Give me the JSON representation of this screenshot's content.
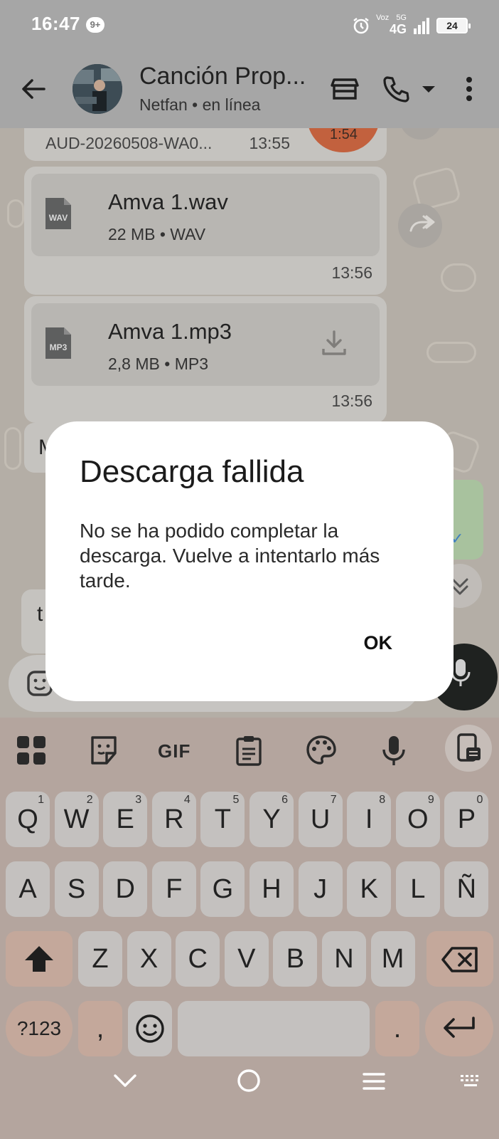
{
  "status_bar": {
    "time": "16:47",
    "notif_badge": "9+",
    "network_voz": "Voz",
    "network_5g": "5G",
    "network_main": "4G",
    "battery": "24"
  },
  "header": {
    "title": "Canción Prop...",
    "subtitle": "Netfan • en línea"
  },
  "chat": {
    "prev_audio_name": "AUD-20260508-WA0...",
    "prev_audio_time": "13:55",
    "prev_audio_duration": "1:54",
    "messages": [
      {
        "file_name": "Amva 1.wav",
        "file_meta": "22 MB • WAV",
        "ext": "WAV",
        "time": "13:56"
      },
      {
        "file_name": "Amva 1.mp3",
        "file_meta": "2,8 MB • MP3",
        "ext": "MP3",
        "time": "13:56"
      }
    ],
    "peek_letter_1": "M",
    "peek_letter_2": "t"
  },
  "dialog": {
    "title": "Descarga fallida",
    "message": "No se ha podido completar la descarga. Vuelve a intentarlo más tarde.",
    "ok": "OK"
  },
  "keyboard": {
    "toolbar_gif": "GIF",
    "row1": [
      {
        "k": "Q",
        "s": "1"
      },
      {
        "k": "W",
        "s": "2"
      },
      {
        "k": "E",
        "s": "3"
      },
      {
        "k": "R",
        "s": "4"
      },
      {
        "k": "T",
        "s": "5"
      },
      {
        "k": "Y",
        "s": "6"
      },
      {
        "k": "U",
        "s": "7"
      },
      {
        "k": "I",
        "s": "8"
      },
      {
        "k": "O",
        "s": "9"
      },
      {
        "k": "P",
        "s": "0"
      }
    ],
    "row2": [
      "A",
      "S",
      "D",
      "F",
      "G",
      "H",
      "J",
      "K",
      "L",
      "Ñ"
    ],
    "row3": [
      "Z",
      "X",
      "C",
      "V",
      "B",
      "N",
      "M"
    ],
    "sym_key": "?123",
    "comma": ",",
    "period": "."
  },
  "colors": {
    "scrim": "#a6a6a6",
    "dialog_bg": "#ffffff",
    "duration_badge": "#c2613e"
  }
}
